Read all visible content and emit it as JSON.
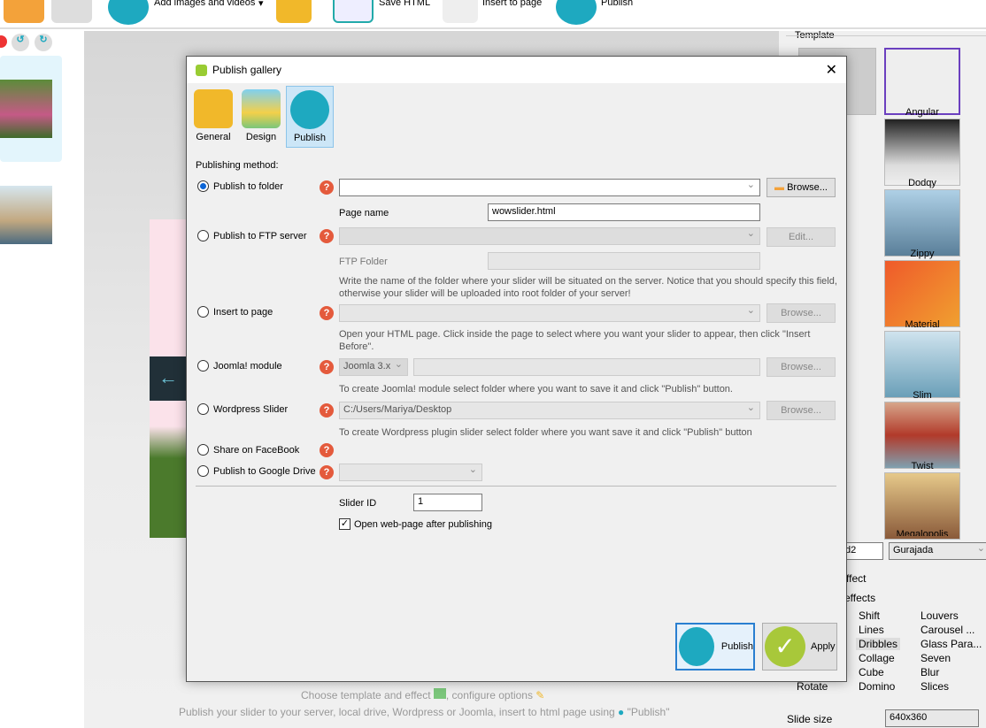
{
  "toolbar": {
    "add_images": "Add images and videos",
    "save_html": "Save HTML",
    "insert_to_page": "Insert to page",
    "publish": "Publish"
  },
  "canvas": {
    "hint1": "Choose template and effect",
    "hint1_tail": ", configure options",
    "hint2": "Publish your slider to your server, local drive, Wordpress or Joomla, insert to html page using",
    "hint2_tail": "\"Publish\""
  },
  "right": {
    "template_group": "Template",
    "templates": [
      "Angular",
      "Dodqy",
      "Zippy",
      "Material",
      "Slim",
      "Twist",
      "Megalopolis"
    ],
    "font_left": "d2",
    "font": "Gurajada",
    "effect_group": "ffect",
    "effects_label": "effects",
    "effects": [
      [
        "Shift",
        "Lines",
        "Dribbles",
        "Collage",
        "Cube",
        "Domino"
      ],
      [
        "Louvers",
        "Carousel ...",
        "Glass Para...",
        "Seven",
        "Blur",
        "Slices"
      ]
    ],
    "effect_rotate": "Rotate",
    "selected_effect": "Dribbles",
    "slide_size_label": "Slide size",
    "slide_size": "640x360"
  },
  "dialog": {
    "title": "Publish gallery",
    "tabs": [
      {
        "label": "General"
      },
      {
        "label": "Design"
      },
      {
        "label": "Publish"
      }
    ],
    "publishing_method": "Publishing method:",
    "options": {
      "folder": {
        "label": "Publish to folder",
        "value": "",
        "browse": "Browse...",
        "page_name_label": "Page name",
        "page_name": "wowslider.html"
      },
      "ftp": {
        "label": "Publish to FTP server",
        "edit": "Edit...",
        "folder_label": "FTP Folder",
        "hint": "Write the name of the folder where your slider will be situated on the server. Notice that you should specify this field, otherwise your slider will be uploaded into root folder of your server!"
      },
      "insert": {
        "label": "Insert to page",
        "browse": "Browse...",
        "hint": "Open your HTML page. Click inside the page to select where you want your slider to appear, then click \"Insert Before\"."
      },
      "joomla": {
        "label": "Joomla! module",
        "version": "Joomla 3.x",
        "browse": "Browse...",
        "hint": "To create Joomla! module select folder where you want to save it and click \"Publish\" button."
      },
      "wordpress": {
        "label": "Wordpress Slider",
        "path": "C:/Users/Mariya/Desktop",
        "browse": "Browse...",
        "hint": "To create Wordpress plugin slider select folder where you want save it and click \"Publish\" button"
      },
      "facebook": {
        "label": "Share on FaceBook"
      },
      "gdrive": {
        "label": "Publish to Google Drive"
      }
    },
    "selected": "folder",
    "slider_id_label": "Slider ID",
    "slider_id": "1",
    "open_after": "Open web-page after publishing",
    "open_after_checked": true,
    "publish_button": "Publish",
    "apply_button": "Apply",
    "help_glyph": "?"
  }
}
